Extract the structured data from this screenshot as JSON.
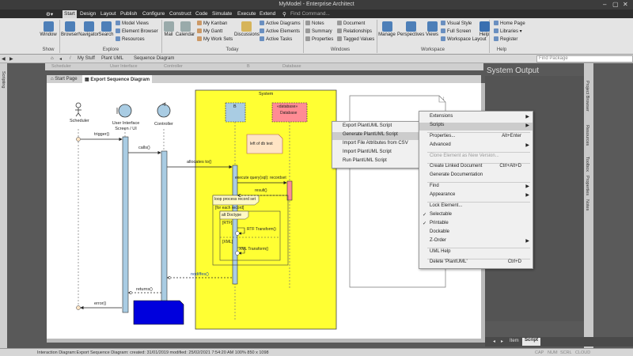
{
  "window": {
    "title": "MyModel - Enterprise Architect"
  },
  "menu": {
    "items": [
      "Start",
      "Design",
      "Layout",
      "Publish",
      "Configure",
      "Construct",
      "Code",
      "Simulate",
      "Execute",
      "Extend"
    ],
    "search_placeholder": "Find Command..."
  },
  "ribbon": {
    "window_label": "Window",
    "browser_label": "Browser",
    "navigator_label": "Navigator",
    "search_label": "Search",
    "model_views": "Model Views",
    "element_browser": "Element Browser",
    "resources": "Resources",
    "mail": "Mail",
    "calendar": "Calendar",
    "my_kanban": "My Kanban",
    "my_gantt": "My Gantt",
    "my_work_sets": "My Work Sets",
    "discussions": "Discussions",
    "active_diagrams": "Active Diagrams",
    "active_elements": "Active Elements",
    "active_tasks": "Active Tasks",
    "notes": "Notes",
    "summary": "Summary",
    "properties": "Properties",
    "document": "Document",
    "relationships": "Relationships",
    "tagged_values": "Tagged Values",
    "manage": "Manage",
    "perspectives": "Perspectives",
    "views": "Views",
    "visual_style": "Visual Style",
    "full_screen": "Full Screen",
    "workspace_layout": "Workspace Layout",
    "help": "Help",
    "home_page": "Home Page",
    "libraries": "Libraries",
    "register": "Register",
    "groups": {
      "show": "Show",
      "explore": "Explore",
      "today": "Today",
      "windows": "Windows",
      "workspace": "Workspace",
      "help": "Help"
    }
  },
  "nav": {
    "path": [
      "My Stuff",
      "Plant UML",
      "Sequence Diagram"
    ],
    "find_placeholder": "Find Package"
  },
  "swimlanes": [
    "Scheduler",
    "User Interface",
    "Controller",
    "B",
    "Database"
  ],
  "tabs": [
    "Start Page",
    "Export Sequence Diagram"
  ],
  "diagram": {
    "actor": "Scheduler",
    "ui": "User Interface Screen / UI",
    "controller": "Controller",
    "system": "System",
    "b": "B",
    "db_stereo": "«database»",
    "db": "Database",
    "note": "left of db test",
    "messages": {
      "trigger": "trigger()",
      "calls": "calls()",
      "allocates": "allocates to()",
      "execute": "execute query(sql): recordset",
      "result": "result()",
      "nodiff": "nodiffes()",
      "returns": "returns()",
      "error": "error()"
    },
    "loop": "loop process record set",
    "for_each": "[for each record]",
    "alt": "alt Doctype",
    "rtf_guard": "[RTF]",
    "rtf_msg": "RTF Transform()",
    "xml_guard": "[XML]",
    "xml_msg": "XML Transform()"
  },
  "panel": {
    "system_output": "System Output"
  },
  "right_tabs": [
    "Project Browser",
    "Resources",
    "Toolbox",
    "Properties",
    "Notes"
  ],
  "context_menu_scripts": [
    "Export PlantUML Script",
    "Generate PlantUML Script",
    "Import File Attributes from CSV",
    "Import PlantUML Script",
    "Run PlantUML Script"
  ],
  "context_menu": {
    "extensions": "Extensions",
    "scripts": "Scripts",
    "properties": "Properties...",
    "properties_sc": "Alt+Enter",
    "advanced": "Advanced",
    "clone": "Clone Element as New Version...",
    "create_linked": "Create Linked Document",
    "create_linked_sc": "Ctrl+Alt+D",
    "generate_doc": "Generate Documentation",
    "find": "Find",
    "appearance": "Appearance",
    "lock": "Lock Element...",
    "selectable": "Selectable",
    "printable": "Printable",
    "dockable": "Dockable",
    "zorder": "Z-Order",
    "uml_help": "UML Help",
    "delete": "Delete 'PlantUML'",
    "delete_sc": "Ctrl+D"
  },
  "bottom_tabs": [
    "Item",
    "Script"
  ],
  "status": {
    "left": "Interaction Diagram:Export Sequence Diagram:  created: 31/01/2019  modified: 25/02/2021 7:54:20 AM   100%   850 x 1098",
    "right": [
      "CAP",
      "NUM",
      "SCRL",
      "CLOUD"
    ]
  },
  "colors": {
    "accent": "#4d7fb8",
    "system_box": "#ffff33",
    "lifeline": "#a9cce3",
    "db": "#ff8c94",
    "note": "#ffe4c4",
    "dark_chrome": "#3c3c3c"
  }
}
